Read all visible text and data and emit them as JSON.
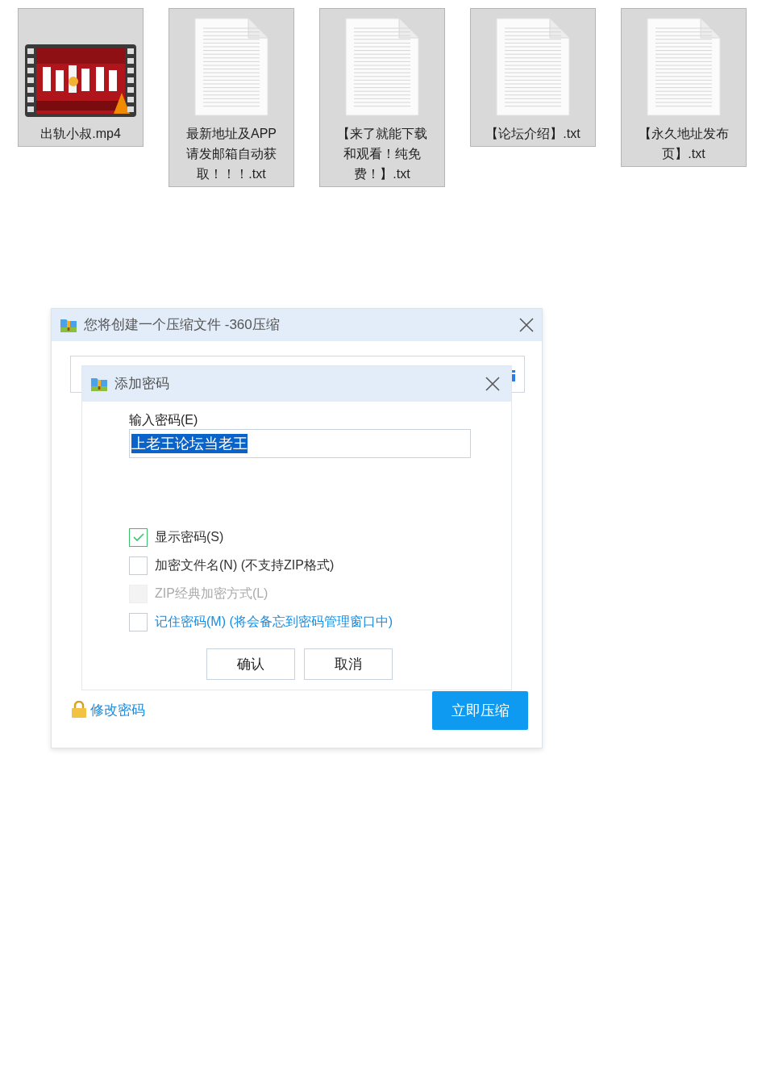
{
  "files": [
    {
      "name": "出轨小叔.mp4",
      "kind": "video"
    },
    {
      "name": "最新地址及APP请发邮箱自动获取！！！.txt",
      "kind": "text"
    },
    {
      "name": "【来了就能下载和观看！纯免费！】.txt",
      "kind": "text"
    },
    {
      "name": "【论坛介绍】.txt",
      "kind": "text"
    },
    {
      "name": "【永久地址发布页】.txt",
      "kind": "text"
    }
  ],
  "dialog": {
    "title": "您将创建一个压缩文件 -360压缩",
    "change_password": "修改密码",
    "compress_button": "立即压缩"
  },
  "password_dialog": {
    "title": "添加密码",
    "field_label": "输入密码(E)",
    "value": "上老王论坛当老王",
    "options": [
      {
        "label": "显示密码(S)",
        "checked": true,
        "disabled": false,
        "kind": "plain"
      },
      {
        "label": "加密文件名(N) (不支持ZIP格式)",
        "checked": false,
        "disabled": false,
        "kind": "plain"
      },
      {
        "label": "ZIP经典加密方式(L)",
        "checked": false,
        "disabled": true,
        "kind": "plain"
      },
      {
        "label": "记住密码(M) (将会备忘到密码管理窗口中)",
        "checked": false,
        "disabled": false,
        "kind": "link"
      }
    ],
    "buttons": [
      "确认",
      "取消"
    ]
  }
}
